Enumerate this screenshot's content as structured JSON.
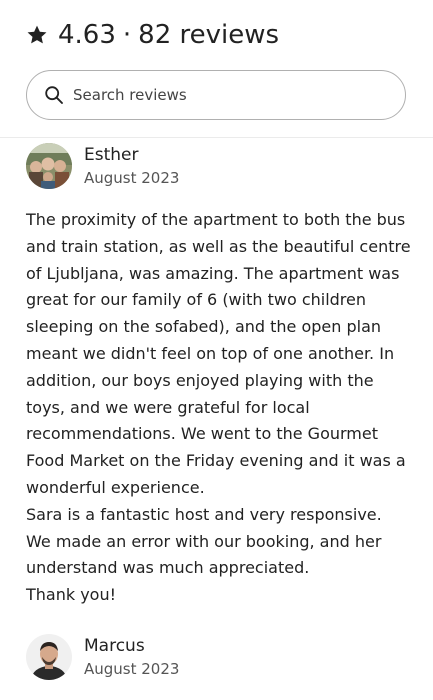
{
  "summary": {
    "rating": "4.63",
    "separator": "·",
    "reviews_label": "82 reviews"
  },
  "search": {
    "placeholder": "Search reviews"
  },
  "reviews": [
    {
      "name": "Esther",
      "date": "August 2023",
      "paragraphs": [
        "The proximity of the apartment to both the bus and train station, as well as the beautiful centre of Ljubljana, was amazing. The apartment was great for our family of 6 (with two children sleeping on the sofabed), and the open plan meant we didn't feel on top of one another. In addition, our boys enjoyed playing with the toys, and we were grateful for local recommendations. We went to the Gourmet Food Market on the Friday evening and it was a wonderful experience.",
        "Sara is a fantastic host and very responsive. We made an error with our booking, and her understand was much appreciated.",
        "Thank you!"
      ]
    },
    {
      "name": "Marcus",
      "date": "August 2023"
    }
  ]
}
